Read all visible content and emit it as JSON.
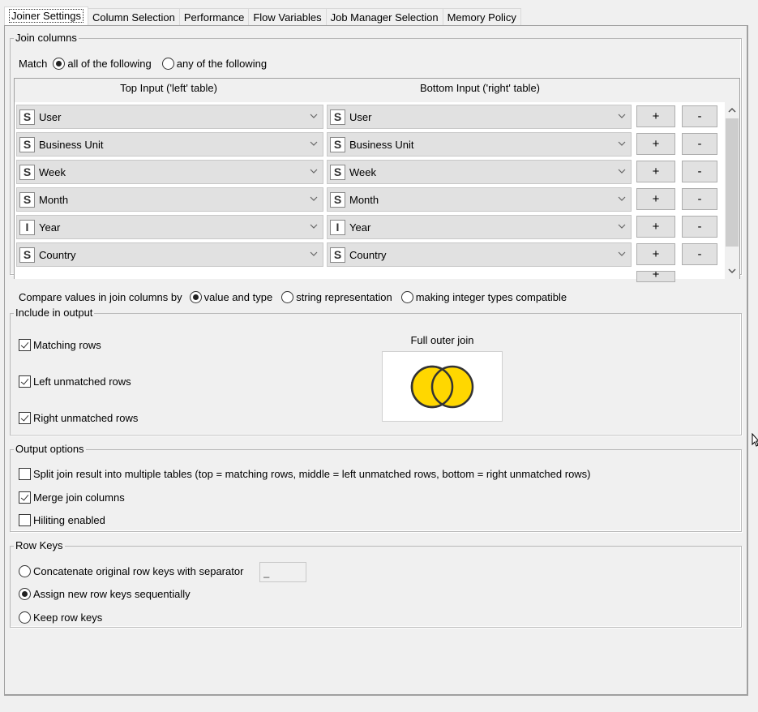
{
  "tabs": [
    {
      "label": "Joiner Settings",
      "active": true
    },
    {
      "label": "Column Selection",
      "active": false
    },
    {
      "label": "Performance",
      "active": false
    },
    {
      "label": "Flow Variables",
      "active": false
    },
    {
      "label": "Job Manager Selection",
      "active": false
    },
    {
      "label": "Memory Policy",
      "active": false
    }
  ],
  "join_columns": {
    "legend": "Join columns",
    "match_label": "Match",
    "match_options": [
      {
        "label": "all of the following",
        "selected": true
      },
      {
        "label": "any of the following",
        "selected": false
      }
    ],
    "left_header": "Top Input ('left' table)",
    "right_header": "Bottom Input ('right' table)",
    "rows": [
      {
        "left_type": "S",
        "left": "User",
        "right_type": "S",
        "right": "User"
      },
      {
        "left_type": "S",
        "left": "Business Unit",
        "right_type": "S",
        "right": "Business Unit"
      },
      {
        "left_type": "S",
        "left": "Week",
        "right_type": "S",
        "right": "Week"
      },
      {
        "left_type": "S",
        "left": "Month",
        "right_type": "S",
        "right": "Month"
      },
      {
        "left_type": "I",
        "left": "Year",
        "right_type": "I",
        "right": "Year"
      },
      {
        "left_type": "S",
        "left": "Country",
        "right_type": "S",
        "right": "Country"
      }
    ],
    "add_label": "+",
    "remove_label": "-",
    "compare_label": "Compare values in join columns by",
    "compare_options": [
      {
        "label": "value and type",
        "selected": true
      },
      {
        "label": "string representation",
        "selected": false
      },
      {
        "label": "making integer types compatible",
        "selected": false
      }
    ]
  },
  "include_output": {
    "legend": "Include in output",
    "options": [
      {
        "label": "Matching rows",
        "checked": true
      },
      {
        "label": "Left unmatched rows",
        "checked": true
      },
      {
        "label": "Right unmatched rows",
        "checked": true
      }
    ],
    "join_type_label": "Full outer join",
    "venn_color": "#ffd700"
  },
  "output_options": {
    "legend": "Output options",
    "options": [
      {
        "label": "Split join result into multiple tables (top = matching rows, middle = left unmatched rows, bottom = right unmatched rows)",
        "checked": false
      },
      {
        "label": "Merge join columns",
        "checked": true
      },
      {
        "label": "Hiliting enabled",
        "checked": false
      }
    ]
  },
  "row_keys": {
    "legend": "Row Keys",
    "options": [
      {
        "label": "Concatenate original row keys with separator",
        "selected": false
      },
      {
        "label": "Assign new row keys sequentially",
        "selected": true
      },
      {
        "label": "Keep row keys",
        "selected": false
      }
    ],
    "separator_value": "_"
  }
}
